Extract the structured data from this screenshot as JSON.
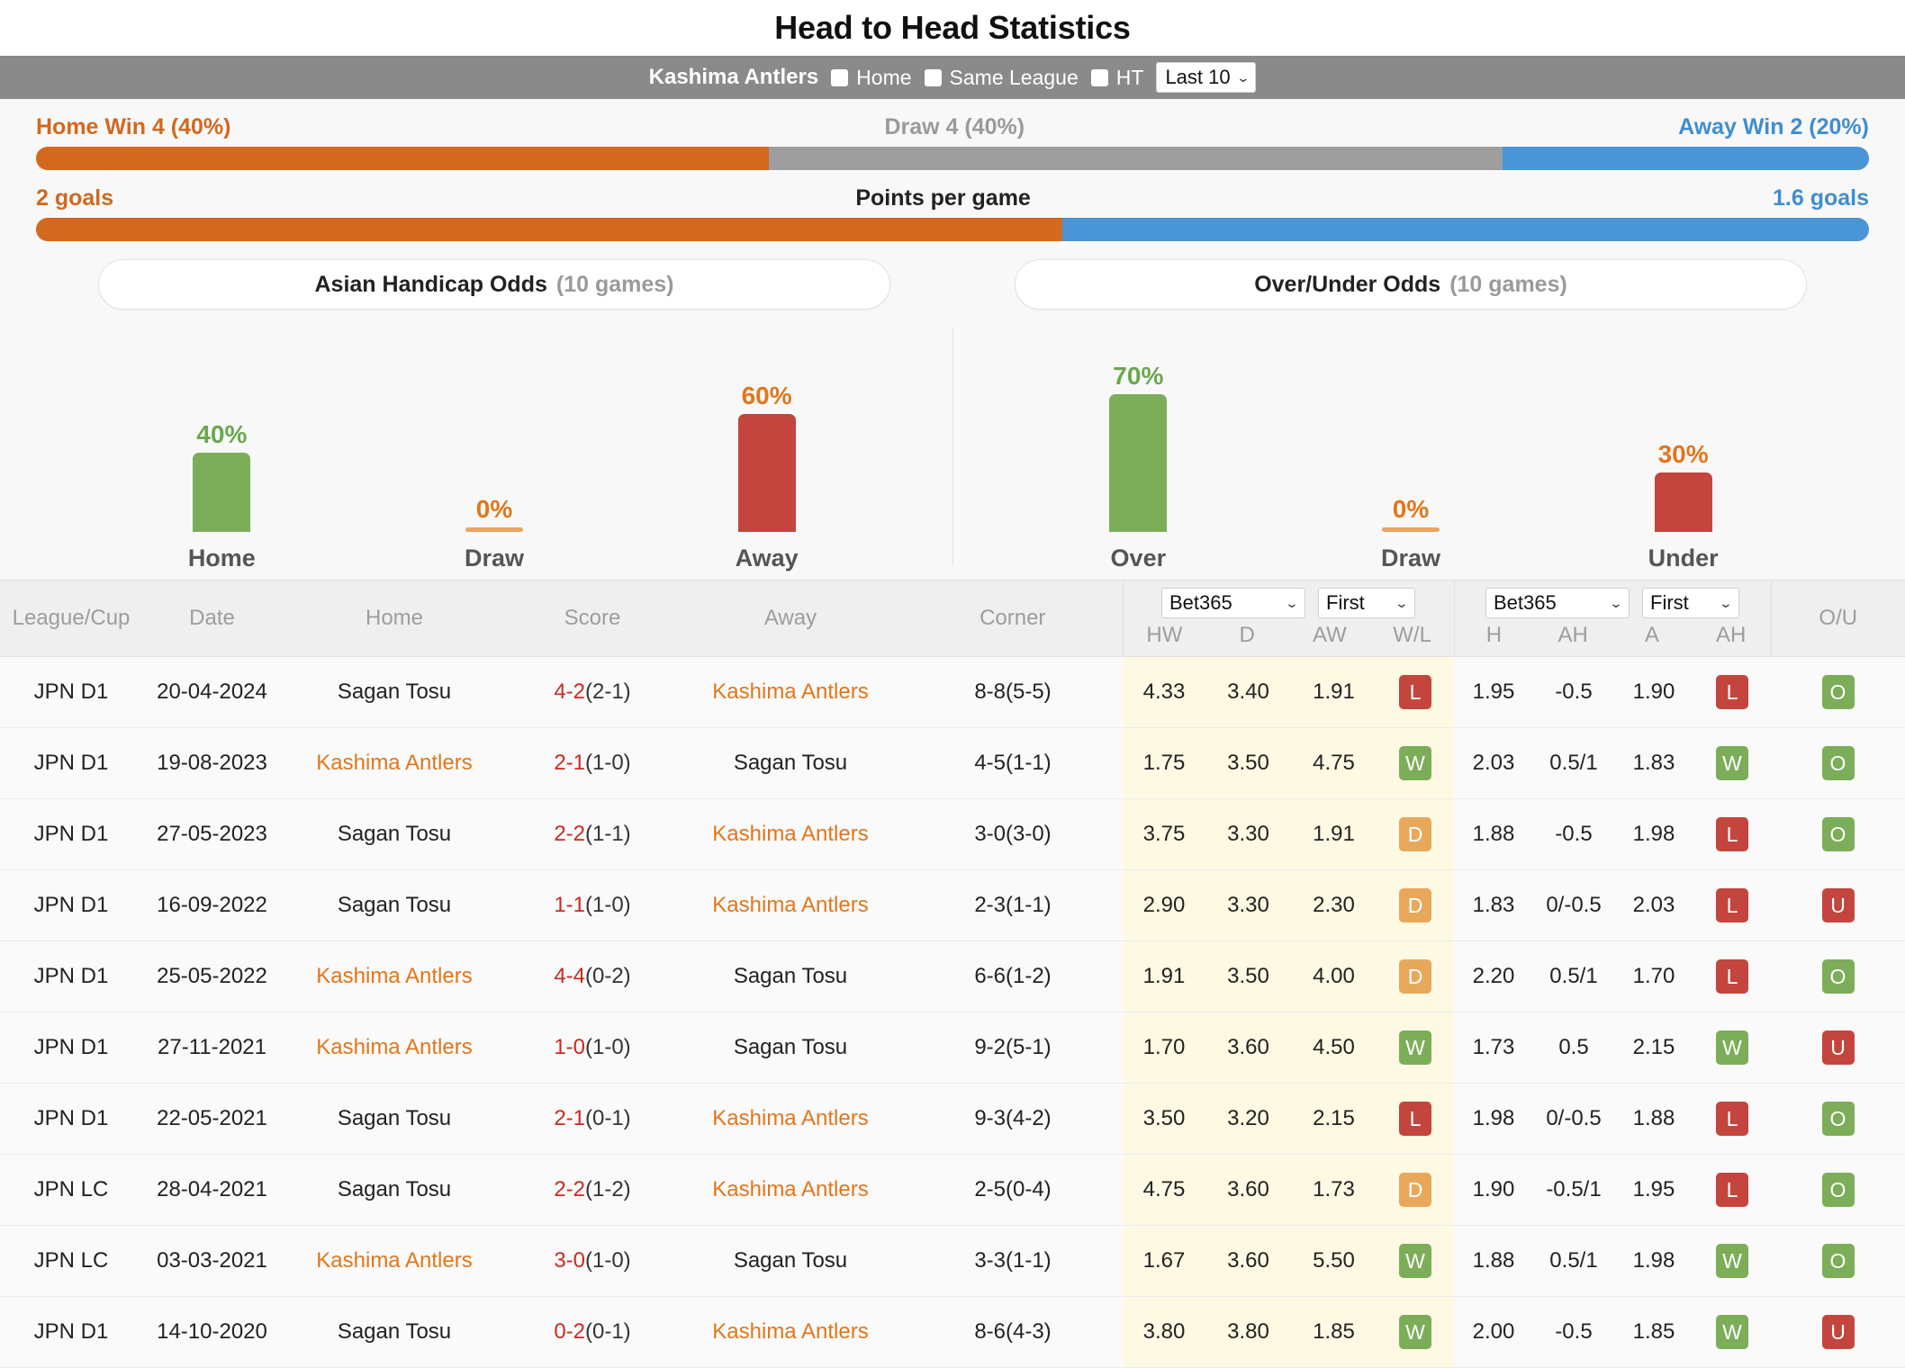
{
  "page_title": "Head to Head Statistics",
  "control_bar": {
    "team": "Kashima Antlers",
    "options": [
      {
        "label": "Home",
        "checked": false
      },
      {
        "label": "Same League",
        "checked": false
      },
      {
        "label": "HT",
        "checked": false
      }
    ],
    "range_select": "Last 10",
    "caret": "chevron-down-icon"
  },
  "summary": {
    "home_label": "Home Win 4 (40%)",
    "draw_label": "Draw 4 (40%)",
    "away_label": "Away Win 2 (20%)",
    "home_pct": 40,
    "draw_pct": 40,
    "away_pct": 20
  },
  "points": {
    "home_goals": "2 goals",
    "title": "Points per game",
    "away_goals": "1.6 goals",
    "home_pct": 56,
    "away_pct": 44
  },
  "buttons": {
    "asian_handicap": "Asian Handicap Odds",
    "asian_handicap_games": "(10 games)",
    "over_under": "Over/Under Odds",
    "over_under_games": "(10 games)"
  },
  "chart_data": [
    {
      "type": "bar",
      "title": "Asian Handicap Odds (10 games)",
      "categories": [
        "Home",
        "Draw",
        "Away"
      ],
      "values": [
        40,
        0,
        60
      ],
      "value_labels": [
        "40%",
        "0%",
        "60%"
      ],
      "colors": [
        "#7cad58",
        "#efa35c",
        "#c4453e"
      ],
      "label_colors": [
        "#6aa84f",
        "#e2761b",
        "#e2761b"
      ],
      "ylabel": "",
      "xlabel": "",
      "ylim": [
        0,
        100
      ],
      "grid": false,
      "legend": "none"
    },
    {
      "type": "bar",
      "title": "Over/Under Odds (10 games)",
      "categories": [
        "Over",
        "Draw",
        "Under"
      ],
      "values": [
        70,
        0,
        30
      ],
      "value_labels": [
        "70%",
        "0%",
        "30%"
      ],
      "colors": [
        "#7cad58",
        "#efa35c",
        "#c4453e"
      ],
      "label_colors": [
        "#6aa84f",
        "#e2761b",
        "#e2761b"
      ],
      "ylabel": "",
      "xlabel": "",
      "ylim": [
        0,
        100
      ],
      "grid": false,
      "legend": "none"
    }
  ],
  "table": {
    "headers": {
      "league": "League/Cup",
      "date": "Date",
      "home": "Home",
      "score": "Score",
      "away": "Away",
      "corner": "Corner",
      "ou": "O/U"
    },
    "group1": {
      "bookmaker": "Bet365",
      "period": "First",
      "subs": [
        "HW",
        "D",
        "AW",
        "W/L"
      ]
    },
    "group2": {
      "bookmaker": "Bet365",
      "period": "First",
      "subs": [
        "H",
        "AH",
        "A",
        "AH"
      ]
    },
    "rows": [
      {
        "league": "JPN D1",
        "date": "20-04-2024",
        "home": "Sagan Tosu",
        "home_hl": false,
        "score": "4-2",
        "ht": "(2-1)",
        "away": "Kashima Antlers",
        "away_hl": true,
        "corner": "8-8(5-5)",
        "hw": "4.33",
        "d": "3.40",
        "aw": "1.91",
        "wl": "L",
        "h": "1.95",
        "ah1": "-0.5",
        "a": "1.90",
        "ah2": "L",
        "ou": "O"
      },
      {
        "league": "JPN D1",
        "date": "19-08-2023",
        "home": "Kashima Antlers",
        "home_hl": true,
        "score": "2-1",
        "ht": "(1-0)",
        "away": "Sagan Tosu",
        "away_hl": false,
        "corner": "4-5(1-1)",
        "hw": "1.75",
        "d": "3.50",
        "aw": "4.75",
        "wl": "W",
        "h": "2.03",
        "ah1": "0.5/1",
        "a": "1.83",
        "ah2": "W",
        "ou": "O"
      },
      {
        "league": "JPN D1",
        "date": "27-05-2023",
        "home": "Sagan Tosu",
        "home_hl": false,
        "score": "2-2",
        "ht": "(1-1)",
        "away": "Kashima Antlers",
        "away_hl": true,
        "corner": "3-0(3-0)",
        "hw": "3.75",
        "d": "3.30",
        "aw": "1.91",
        "wl": "D",
        "h": "1.88",
        "ah1": "-0.5",
        "a": "1.98",
        "ah2": "L",
        "ou": "O"
      },
      {
        "league": "JPN D1",
        "date": "16-09-2022",
        "home": "Sagan Tosu",
        "home_hl": false,
        "score": "1-1",
        "ht": "(1-0)",
        "away": "Kashima Antlers",
        "away_hl": true,
        "corner": "2-3(1-1)",
        "hw": "2.90",
        "d": "3.30",
        "aw": "2.30",
        "wl": "D",
        "h": "1.83",
        "ah1": "0/-0.5",
        "a": "2.03",
        "ah2": "L",
        "ou": "U"
      },
      {
        "league": "JPN D1",
        "date": "25-05-2022",
        "home": "Kashima Antlers",
        "home_hl": true,
        "score": "4-4",
        "ht": "(0-2)",
        "away": "Sagan Tosu",
        "away_hl": false,
        "corner": "6-6(1-2)",
        "hw": "1.91",
        "d": "3.50",
        "aw": "4.00",
        "wl": "D",
        "h": "2.20",
        "ah1": "0.5/1",
        "a": "1.70",
        "ah2": "L",
        "ou": "O"
      },
      {
        "league": "JPN D1",
        "date": "27-11-2021",
        "home": "Kashima Antlers",
        "home_hl": true,
        "score": "1-0",
        "ht": "(1-0)",
        "away": "Sagan Tosu",
        "away_hl": false,
        "corner": "9-2(5-1)",
        "hw": "1.70",
        "d": "3.60",
        "aw": "4.50",
        "wl": "W",
        "h": "1.73",
        "ah1": "0.5",
        "a": "2.15",
        "ah2": "W",
        "ou": "U"
      },
      {
        "league": "JPN D1",
        "date": "22-05-2021",
        "home": "Sagan Tosu",
        "home_hl": false,
        "score": "2-1",
        "ht": "(0-1)",
        "away": "Kashima Antlers",
        "away_hl": true,
        "corner": "9-3(4-2)",
        "hw": "3.50",
        "d": "3.20",
        "aw": "2.15",
        "wl": "L",
        "h": "1.98",
        "ah1": "0/-0.5",
        "a": "1.88",
        "ah2": "L",
        "ou": "O"
      },
      {
        "league": "JPN LC",
        "date": "28-04-2021",
        "home": "Sagan Tosu",
        "home_hl": false,
        "score": "2-2",
        "ht": "(1-2)",
        "away": "Kashima Antlers",
        "away_hl": true,
        "corner": "2-5(0-4)",
        "hw": "4.75",
        "d": "3.60",
        "aw": "1.73",
        "wl": "D",
        "h": "1.90",
        "ah1": "-0.5/1",
        "a": "1.95",
        "ah2": "L",
        "ou": "O"
      },
      {
        "league": "JPN LC",
        "date": "03-03-2021",
        "home": "Kashima Antlers",
        "home_hl": true,
        "score": "3-0",
        "ht": "(1-0)",
        "away": "Sagan Tosu",
        "away_hl": false,
        "corner": "3-3(1-1)",
        "hw": "1.67",
        "d": "3.60",
        "aw": "5.50",
        "wl": "W",
        "h": "1.88",
        "ah1": "0.5/1",
        "a": "1.98",
        "ah2": "W",
        "ou": "O"
      },
      {
        "league": "JPN D1",
        "date": "14-10-2020",
        "home": "Sagan Tosu",
        "home_hl": false,
        "score": "0-2",
        "ht": "(0-1)",
        "away": "Kashima Antlers",
        "away_hl": true,
        "corner": "8-6(4-3)",
        "hw": "3.80",
        "d": "3.80",
        "aw": "1.85",
        "wl": "W",
        "h": "2.00",
        "ah1": "-0.5",
        "a": "1.85",
        "ah2": "W",
        "ou": "U"
      }
    ]
  },
  "colors": {
    "orange": "#d2691e",
    "blue": "#4a95d6",
    "gray": "#9e9e9e",
    "green": "#7cad58",
    "red": "#c4453e",
    "amber": "#e8a85c"
  }
}
